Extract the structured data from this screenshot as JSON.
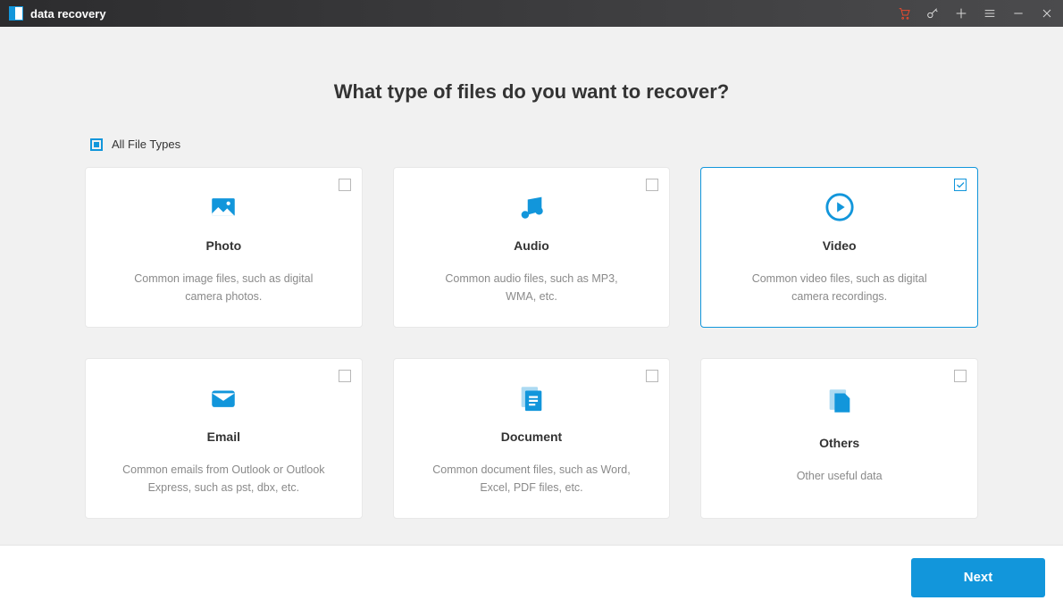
{
  "app": {
    "title": "data recovery"
  },
  "heading": "What type of files do you want to recover?",
  "all_files_label": "All File Types",
  "cards": {
    "photo": {
      "title": "Photo",
      "desc": "Common image files, such as digital camera photos."
    },
    "audio": {
      "title": "Audio",
      "desc": "Common audio files, such as MP3, WMA, etc."
    },
    "video": {
      "title": "Video",
      "desc": "Common video files, such as digital camera recordings."
    },
    "email": {
      "title": "Email",
      "desc": "Common emails from Outlook or Outlook Express, such as pst, dbx, etc."
    },
    "document": {
      "title": "Document",
      "desc": "Common document files, such as Word, Excel, PDF files, etc."
    },
    "others": {
      "title": "Others",
      "desc": "Other useful data"
    }
  },
  "footer": {
    "next_label": "Next"
  }
}
